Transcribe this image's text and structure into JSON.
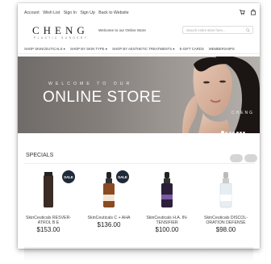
{
  "top_links": [
    "Account",
    "Wish List",
    "Sign In",
    "Sign Up",
    "Back to Website"
  ],
  "logo": {
    "main": "CHENG",
    "sub": "PLASTIC SURGERY"
  },
  "welcome": "Welcome to our Online Store",
  "search": {
    "placeholder": "Search entire store here..."
  },
  "nav": [
    "SHOP SKINCEUTICALS ▾",
    "SHOP BY SKIN TYPE ▾",
    "SHOP BY AESTHETIC TREATMENTS ▾",
    "E-GIFT CARDS",
    "MEMBERSHIPS"
  ],
  "hero": {
    "pre_title": "WELCOME TO OUR",
    "title": "ONLINE STORE",
    "brand": "CHENG",
    "dots": 7,
    "active_dot": 0
  },
  "specials": {
    "heading": "SPECIALS"
  },
  "products": [
    {
      "name_line1": "SkinCeuticals RESVER-",
      "name_line2": "ATROL B E",
      "price": "$153.00",
      "sale": "SALE",
      "color": "#3a2b25"
    },
    {
      "name_line1": "SkinCeuticals C + AHA",
      "name_line2": "",
      "price": "$136.00",
      "sale": "SALE",
      "color": "#8a4b22"
    },
    {
      "name_line1": "SkinCeuticals H.A. IN-",
      "name_line2": "TENSIFIER",
      "price": "$100.00",
      "sale": "",
      "color": "#2c1f3a"
    },
    {
      "name_line1": "SkinCeuticals DISCOL-",
      "name_line2": "ORATION DEFENSE",
      "price": "$98.00",
      "sale": "",
      "color": "#e6eef2"
    }
  ],
  "colors": {
    "sale_badge": "#1f2a38",
    "hero": "#857f7b"
  }
}
